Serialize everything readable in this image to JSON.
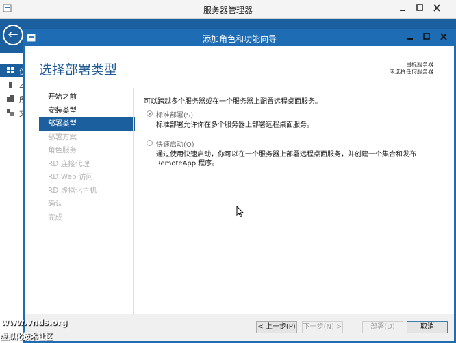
{
  "server_manager": {
    "title": "服务器管理器",
    "left_icons": [
      "dashboard-icon",
      "local-server-icon",
      "all-servers-icon",
      "file-services-icon"
    ],
    "left_labels": [
      "仪",
      "本",
      "所",
      "文"
    ]
  },
  "wizard": {
    "title": "添加角色和功能向导",
    "heading": "选择部署类型",
    "destination_label": "目标服务器",
    "destination_value": "未选择任何服务器",
    "nav_items": [
      {
        "label": "开始之前",
        "state": "done"
      },
      {
        "label": "安装类型",
        "state": "done"
      },
      {
        "label": "部署类型",
        "state": "active"
      },
      {
        "label": "部署方案",
        "state": "disabled"
      },
      {
        "label": "角色服务",
        "state": "disabled"
      },
      {
        "label": "RD 连接代理",
        "state": "disabled"
      },
      {
        "label": "RD Web 访问",
        "state": "disabled"
      },
      {
        "label": "RD 虚拟化主机",
        "state": "disabled"
      },
      {
        "label": "确认",
        "state": "disabled"
      },
      {
        "label": "完成",
        "state": "disabled"
      }
    ],
    "intro": "可以跨越多个服务器或在一个服务器上配置远程桌面服务。",
    "options": [
      {
        "label": "标准部署(S)",
        "checked": true,
        "description": "标准部署允许你在多个服务器上部署远程桌面服务。"
      },
      {
        "label": "快速启动(Q)",
        "checked": false,
        "description": "通过使用快速启动，你可以在一个服务器上部署远程桌面服务，并创建一个集合和发布 RemoteApp 程序。"
      }
    ],
    "buttons": {
      "previous": "< 上一步(P)",
      "next": "下一步(N) >",
      "deploy": "部署(D)",
      "cancel": "取消"
    }
  },
  "watermark": {
    "line1": "www.vnds.org",
    "line2": "虚拟化技术社区"
  }
}
